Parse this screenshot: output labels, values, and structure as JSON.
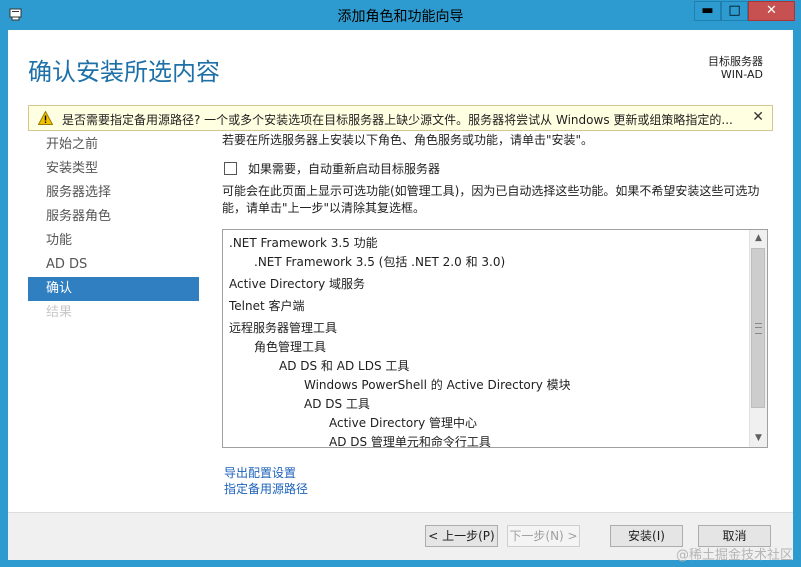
{
  "window": {
    "title": "添加角色和功能向导",
    "minimize_glyph": "▬",
    "maximize_glyph": "□",
    "close_glyph": "✕"
  },
  "header": {
    "page_title": "确认安装所选内容",
    "server_label": "目标服务器",
    "server_name": "WIN-AD"
  },
  "warning": {
    "text": "是否需要指定备用源路径? 一个或多个安装选项在目标服务器上缺少源文件。服务器将尝试从 Windows 更新或组策略指定的...",
    "close_glyph": "✕"
  },
  "nav": {
    "items": [
      {
        "label": "开始之前",
        "state": "normal"
      },
      {
        "label": "安装类型",
        "state": "normal"
      },
      {
        "label": "服务器选择",
        "state": "normal"
      },
      {
        "label": "服务器角色",
        "state": "normal"
      },
      {
        "label": "功能",
        "state": "normal"
      },
      {
        "label": "AD DS",
        "state": "normal"
      },
      {
        "label": "确认",
        "state": "active"
      },
      {
        "label": "结果",
        "state": "disabled"
      }
    ]
  },
  "content": {
    "intro": "若要在所选服务器上安装以下角色、角色服务或功能，请单击\"安装\"。",
    "restart_checkbox_label": "如果需要，自动重新启动目标服务器",
    "restart_checked": false,
    "note": "可能会在此页面上显示可选功能(如管理工具)，因为已自动选择这些功能。如果不希望安装这些可选功能，请单击\"上一步\"以清除其复选框。",
    "list": [
      {
        "text": ".NET Framework 3.5 功能",
        "indent": 0
      },
      {
        "text": ".NET Framework 3.5 (包括 .NET 2.0 和 3.0)",
        "indent": 1
      },
      {
        "text": "Active Directory 域服务",
        "indent": 0,
        "gap": true
      },
      {
        "text": "Telnet 客户端",
        "indent": 0,
        "gap": true
      },
      {
        "text": "远程服务器管理工具",
        "indent": 0,
        "gap": true
      },
      {
        "text": "角色管理工具",
        "indent": 1
      },
      {
        "text": "AD DS 和 AD LDS 工具",
        "indent": 2
      },
      {
        "text": "Windows PowerShell 的 Active Directory 模块",
        "indent": 3
      },
      {
        "text": "AD DS 工具",
        "indent": 3
      },
      {
        "text": "Active Directory 管理中心",
        "indent": 4
      },
      {
        "text": "AD DS 管理单元和命令行工具",
        "indent": 4
      }
    ],
    "export_link": "导出配置设置",
    "source_link": "指定备用源路径"
  },
  "buttons": {
    "prev": "< 上一步(P)",
    "next": "下一步(N) >",
    "install": "安装(I)",
    "cancel": "取消"
  },
  "watermark": "@稀土掘金技术社区",
  "colors": {
    "accent": "#2d9bcf",
    "title": "#1e70a8",
    "nav_active": "#2f7fc1",
    "link": "#1c62b9",
    "warning_bg": "#ffffe1"
  }
}
